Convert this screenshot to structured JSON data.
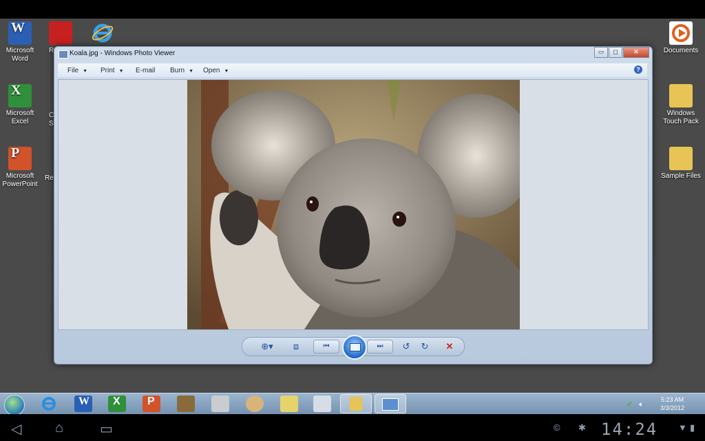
{
  "desktop": {
    "left_icons": [
      {
        "label": "Microsoft\nWord",
        "icon": "word-icon"
      },
      {
        "label": "Microsoft\nExcel",
        "icon": "excel-icon"
      },
      {
        "label": "Microsoft\nPowerPoint",
        "icon": "powerpoint-icon"
      }
    ],
    "partial_labels": [
      "R",
      "C\nS",
      "Re"
    ],
    "right_icons": [
      {
        "label": "Documents",
        "icon": "documents-icon"
      },
      {
        "label": "Windows\nTouch Pack",
        "icon": "folder-icon"
      },
      {
        "label": "Sample Files",
        "icon": "folder-icon"
      }
    ]
  },
  "window": {
    "title": "Koala.jpg - Windows Photo Viewer",
    "menu": {
      "file": "File",
      "print": "Print",
      "email": "E-mail",
      "burn": "Burn",
      "open": "Open"
    },
    "help_glyph": "?",
    "controls": {
      "minimize": "▭",
      "maximize": "◻",
      "close": "✕"
    },
    "photo_subject": "koala"
  },
  "viewer_toolbar": {
    "zoom_glyph": "⊕▾",
    "fit_glyph": "⧈",
    "prev_glyph": "⏮",
    "next_glyph": "⏭",
    "rotate_ccw_glyph": "↺",
    "rotate_cw_glyph": "↻",
    "delete_glyph": "✕"
  },
  "taskbar": {
    "time": "5:23 AM",
    "date": "3/3/2012"
  },
  "android_bar": {
    "clock": "14:24",
    "back_glyph": "◁",
    "home_glyph": "⌂",
    "recent_glyph": "▭"
  },
  "colors": {
    "desktop": "#4a4a4a",
    "window_frame": "#cfdceb",
    "accent": "#2f66c4",
    "delete": "#d02020"
  }
}
